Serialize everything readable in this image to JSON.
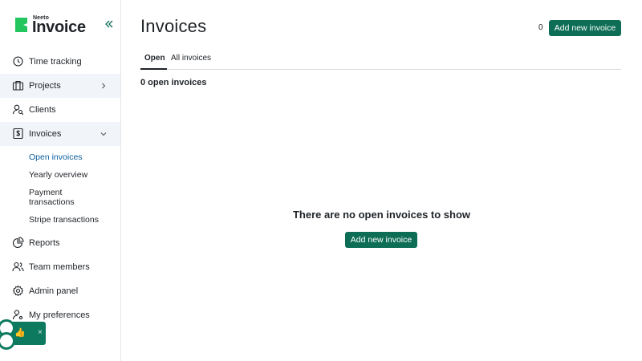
{
  "brand": {
    "small": "Neeto",
    "big": "Invoice",
    "accent": "#0d6e55",
    "logo_color": "#22c55e"
  },
  "sidebar": {
    "items": [
      {
        "label": "Time tracking",
        "icon": "clock-icon"
      },
      {
        "label": "Projects",
        "icon": "briefcase-icon"
      },
      {
        "label": "Clients",
        "icon": "user-search-icon"
      },
      {
        "label": "Invoices",
        "icon": "dollar-document-icon"
      },
      {
        "label": "Reports",
        "icon": "pie-chart-icon"
      },
      {
        "label": "Team members",
        "icon": "users-icon"
      },
      {
        "label": "Admin panel",
        "icon": "gear-icon"
      },
      {
        "label": "My preferences",
        "icon": "user-settings-icon"
      }
    ],
    "invoice_subitems": [
      {
        "label": "Open invoices"
      },
      {
        "label": "Yearly overview"
      },
      {
        "label": "Payment transactions"
      },
      {
        "label": "Stripe transactions"
      }
    ]
  },
  "main": {
    "title": "Invoices",
    "count": "0",
    "add_button": "Add new invoice",
    "tabs": [
      {
        "label": "Open"
      },
      {
        "label": "All invoices"
      }
    ],
    "open_count_text": "0 open invoices",
    "empty_message": "There are no open invoices to show",
    "empty_button": "Add new invoice"
  },
  "feedback": {
    "thumb": "👍",
    "close": "×"
  }
}
